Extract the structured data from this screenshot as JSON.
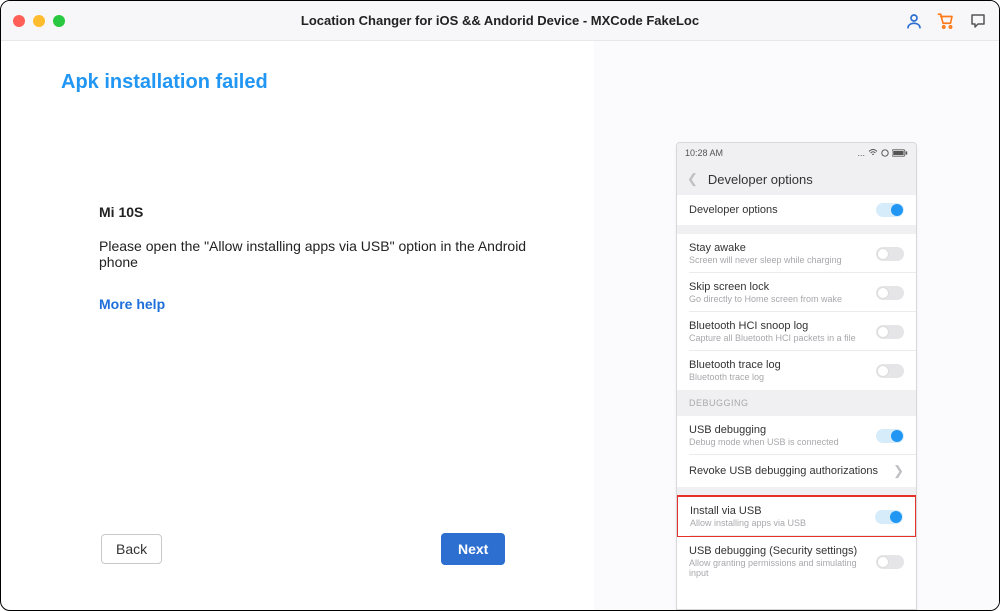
{
  "window": {
    "title": "Location Changer for iOS && Andorid Device - MXCode FakeLoc"
  },
  "page": {
    "heading": "Apk installation failed",
    "device": "Mi 10S",
    "instruction": "Please open the \"Allow installing apps via USB\" option in the Android phone",
    "help_link": "More help",
    "back": "Back",
    "next": "Next"
  },
  "phone": {
    "time": "10:28 AM",
    "screen_title": "Developer  options",
    "debugging_label": "DEBUGGING",
    "items": {
      "dev_options": {
        "title": "Developer options"
      },
      "stay_awake": {
        "title": "Stay awake",
        "sub": "Screen will never sleep while charging"
      },
      "skip_lock": {
        "title": "Skip screen lock",
        "sub": "Go directly to Home screen from wake"
      },
      "hci_snoop": {
        "title": "Bluetooth HCI snoop log",
        "sub": "Capture all Bluetooth HCI packets in a file"
      },
      "bt_trace": {
        "title": "Bluetooth trace log",
        "sub": "Bluetooth trace log"
      },
      "usb_debug": {
        "title": "USB debugging",
        "sub": "Debug mode when USB is connected"
      },
      "revoke": {
        "title": "Revoke USB debugging authorizations"
      },
      "install_usb": {
        "title": "Install via USB",
        "sub": "Allow installing apps via USB"
      },
      "usb_sec": {
        "title": "USB debugging (Security settings)",
        "sub": "Allow granting permissions and simulating input"
      }
    }
  }
}
